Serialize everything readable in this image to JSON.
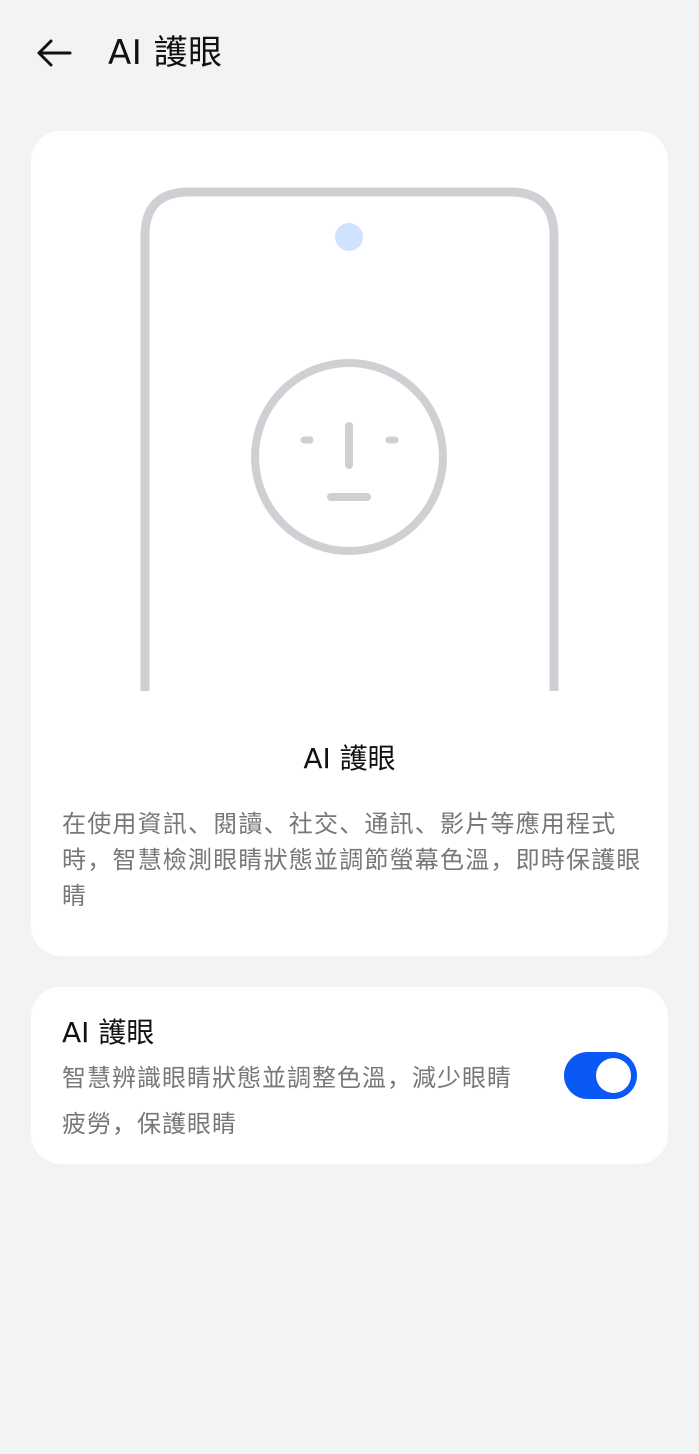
{
  "header": {
    "title": "AI 護眼",
    "back_icon": "arrow-left-icon"
  },
  "hero": {
    "title": "AI 護眼",
    "description": "在使用資訊、閱讀、社交、通訊、影片等應用程式時，智慧檢測眼睛狀態並調節螢幕色溫，即時保護眼睛"
  },
  "setting": {
    "title": "AI 護眼",
    "description": "智慧辨識眼睛狀態並調整色溫，減少眼睛疲勞，保護眼睛",
    "enabled": true
  },
  "colors": {
    "background": "#f2f3f5",
    "card": "#ffffff",
    "accent": "#0a59f7",
    "illustration_stroke": "#cfd0d4",
    "camera_dot": "#cfe2ff"
  }
}
